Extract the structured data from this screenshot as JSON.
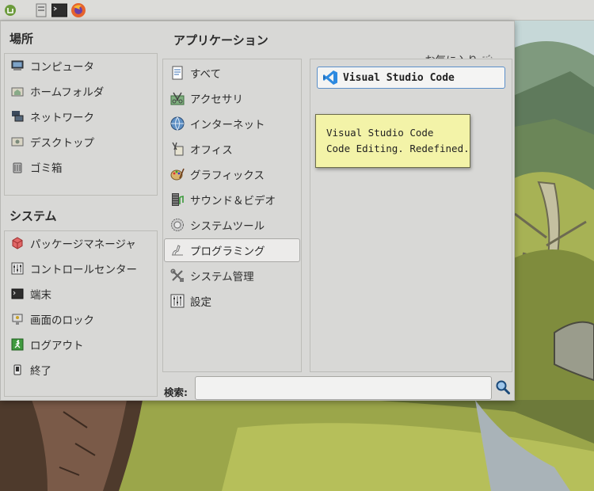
{
  "panel": {
    "icons": [
      "mint-menu-icon",
      "files-icon",
      "terminal-icon",
      "firefox-icon"
    ]
  },
  "menu": {
    "places": {
      "title": "場所",
      "items": [
        {
          "label": "コンピュータ",
          "icon": "computer-icon"
        },
        {
          "label": "ホームフォルダ",
          "icon": "home-folder-icon"
        },
        {
          "label": "ネットワーク",
          "icon": "network-icon"
        },
        {
          "label": "デスクトップ",
          "icon": "desktop-icon"
        },
        {
          "label": "ゴミ箱",
          "icon": "trash-icon"
        }
      ]
    },
    "system": {
      "title": "システム",
      "items": [
        {
          "label": "パッケージマネージャ",
          "icon": "package-icon"
        },
        {
          "label": "コントロールセンター",
          "icon": "control-center-icon"
        },
        {
          "label": "端末",
          "icon": "terminal-icon"
        },
        {
          "label": "画面のロック",
          "icon": "lock-icon"
        },
        {
          "label": "ログアウト",
          "icon": "logout-icon"
        },
        {
          "label": "終了",
          "icon": "quit-icon"
        }
      ]
    },
    "applications": {
      "title": "アプリケーション",
      "favorites_label": "お気に入り",
      "categories": [
        {
          "label": "すべて",
          "icon": "all-apps-icon"
        },
        {
          "label": "アクセサリ",
          "icon": "accessories-icon"
        },
        {
          "label": "インターネット",
          "icon": "internet-icon"
        },
        {
          "label": "オフィス",
          "icon": "office-icon"
        },
        {
          "label": "グラフィックス",
          "icon": "graphics-icon"
        },
        {
          "label": "サウンド＆ビデオ",
          "icon": "sound-video-icon"
        },
        {
          "label": "システムツール",
          "icon": "system-tools-icon"
        },
        {
          "label": "プログラミング",
          "icon": "programming-icon",
          "selected": true
        },
        {
          "label": "システム管理",
          "icon": "administration-icon"
        },
        {
          "label": "設定",
          "icon": "settings-icon"
        }
      ],
      "apps": [
        {
          "label": "Visual Studio Code",
          "icon": "vscode-icon"
        }
      ],
      "tooltip": {
        "line1": "Visual Studio Code",
        "line2": "Code Editing. Redefined."
      }
    },
    "search": {
      "label": "検索:",
      "value": "",
      "placeholder": ""
    }
  }
}
